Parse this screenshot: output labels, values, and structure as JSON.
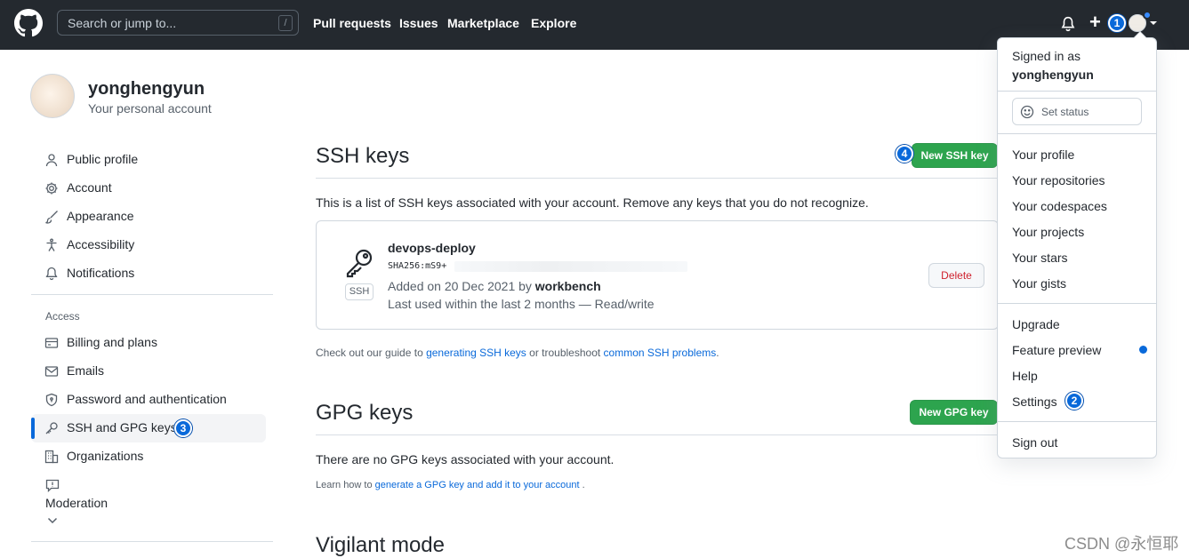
{
  "header": {
    "search_placeholder": "Search or jump to...",
    "slash_key": "/",
    "nav": [
      "Pull requests",
      "Issues",
      "Marketplace",
      "Explore"
    ],
    "plus": "+",
    "callouts": {
      "plus": "1",
      "settings": "2",
      "ssh_nav": "3",
      "new_key": "4"
    }
  },
  "profile": {
    "username": "yonghengyun",
    "subtitle": "Your personal account"
  },
  "sidebar": {
    "items": [
      {
        "label": "Public profile",
        "icon": "person-icon"
      },
      {
        "label": "Account",
        "icon": "gear-icon"
      },
      {
        "label": "Appearance",
        "icon": "paintbrush-icon"
      },
      {
        "label": "Accessibility",
        "icon": "accessibility-icon"
      },
      {
        "label": "Notifications",
        "icon": "bell-icon"
      }
    ],
    "access_heading": "Access",
    "access_items": [
      {
        "label": "Billing and plans",
        "icon": "credit-card-icon"
      },
      {
        "label": "Emails",
        "icon": "mail-icon"
      },
      {
        "label": "Password and authentication",
        "icon": "shield-lock-icon"
      },
      {
        "label": "SSH and GPG keys",
        "icon": "key-icon",
        "selected": true
      },
      {
        "label": "Organizations",
        "icon": "organization-icon"
      }
    ],
    "moderation": "Moderation"
  },
  "ssh": {
    "title": "SSH keys",
    "new_button": "New SSH key",
    "description": "This is a list of SSH keys associated with your account. Remove any keys that you do not recognize.",
    "key": {
      "name": "devops-deploy",
      "tag": "SSH",
      "fingerprint": "SHA256:mS9+",
      "added_prefix": "Added on 20 Dec 2021 by ",
      "added_by": "workbench",
      "last_used": "Last used within the last 2 months — Read/write",
      "delete_label": "Delete"
    },
    "guide_prefix": "Check out our guide to ",
    "guide_link1": "generating SSH keys",
    "guide_middle": " or troubleshoot ",
    "guide_link2": "common SSH problems",
    "guide_suffix": "."
  },
  "gpg": {
    "title": "GPG keys",
    "new_button": "New GPG key",
    "empty": "There are no GPG keys associated with your account.",
    "learn_prefix": "Learn how to ",
    "learn_link": "generate a GPG key and add it to your account",
    "learn_suffix": " ."
  },
  "vigilant": {
    "title": "Vigilant mode"
  },
  "dropdown": {
    "signed_in_as": "Signed in as",
    "username": "yonghengyun",
    "set_status": "Set status",
    "group1": [
      "Your profile",
      "Your repositories",
      "Your codespaces",
      "Your projects",
      "Your stars",
      "Your gists"
    ],
    "group2": [
      "Upgrade",
      "Feature preview",
      "Help",
      "Settings"
    ],
    "sign_out": "Sign out"
  },
  "watermark": "CSDN @永恒耶",
  "colors": {
    "header_bg": "#24292f",
    "accent": "#0969da",
    "green": "#2da44e",
    "danger": "#cf222e"
  }
}
